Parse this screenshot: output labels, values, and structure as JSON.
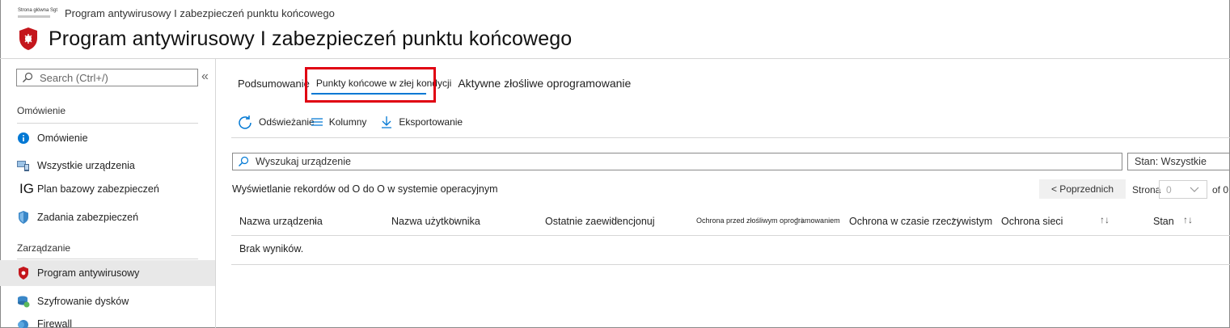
{
  "breadcrumb": {
    "home": "Strona główna Sgt",
    "current": "Program antywirusowy I zabezpieczeń punktu końcowego"
  },
  "page": {
    "title": "Program antywirusowy I zabezpieczeń punktu końcowego",
    "icon": "shield-bug-icon"
  },
  "sidebar": {
    "search_placeholder": "Search (Ctrl+/)",
    "collapse": "«",
    "section_overview": "Omówienie",
    "section_manage": "Zarządzanie",
    "items": [
      {
        "label": "Omówienie",
        "icon": "info-icon"
      },
      {
        "label": "Wszystkie urządzenia",
        "icon": "devices-icon"
      },
      {
        "label": "Plan bazowy zabezpieczeń",
        "icon": "ig-text-icon",
        "icon_text": "IG"
      },
      {
        "label": "Zadania zabezpieczeń",
        "icon": "security-shield-icon"
      },
      {
        "label": "Program antywirusowy",
        "icon": "antivirus-shield-icon",
        "active": true
      },
      {
        "label": "Szyfrowanie dysków",
        "icon": "disk-encryption-icon"
      },
      {
        "label": "Firewall",
        "icon": "firewall-icon"
      }
    ]
  },
  "tabs": [
    {
      "label": "Podsumowanie"
    },
    {
      "label": "Punkty końcowe w złej kondycji",
      "selected": true
    },
    {
      "label": "Aktywne złośliwe oprogramowanie"
    }
  ],
  "toolbar": {
    "refresh": "Odświeżanie",
    "columns": "Kolumny",
    "export": "Eksportowanie"
  },
  "filter": {
    "search_placeholder": "Wyszukaj urządzenie",
    "status": "Stan: Wszystkie"
  },
  "records_text": "Wyświetlanie rekordów od O do O w systemie operacyjnym",
  "pagination": {
    "prev": "< Poprzednich",
    "page_label": "Strona",
    "page_value": "0",
    "of": "of 0"
  },
  "table": {
    "columns": [
      "Nazwa urządzenia",
      "Nazwa użytkownika",
      "Ostatnie zaewidencjonuj",
      "Ochrona przed złośliwym oprogramowaniem",
      "Ochrona w czasie rzeczywistym",
      "Ochrona sieci",
      "Stan"
    ],
    "empty_text": "Brak wyników."
  },
  "colors": {
    "accent": "#0078d4",
    "highlight": "#e00012",
    "shield_red": "#c4161c"
  }
}
